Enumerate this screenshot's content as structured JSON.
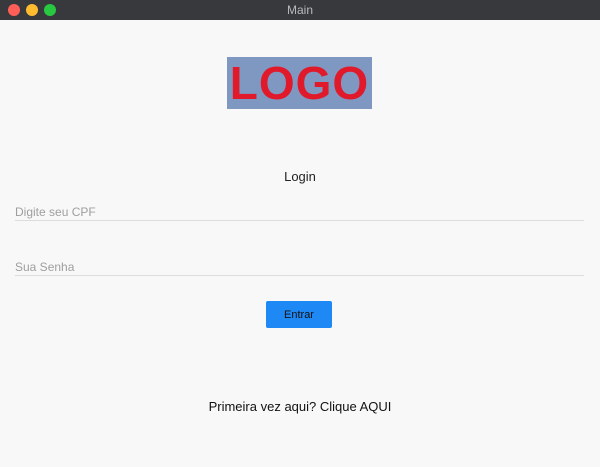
{
  "window": {
    "title": "Main"
  },
  "logo": {
    "text": "LOGO",
    "background_color": "#7e98c2",
    "text_color": "#e01a2a"
  },
  "login": {
    "heading": "Login",
    "cpf_placeholder": "Digite seu CPF",
    "password_placeholder": "Sua Senha",
    "submit_label": "Entrar",
    "signup_text": "Primeira vez aqui? Clique AQUI"
  },
  "colors": {
    "accent": "#1e88f5",
    "titlebar": "#38393c",
    "background": "#f8f8f8"
  }
}
